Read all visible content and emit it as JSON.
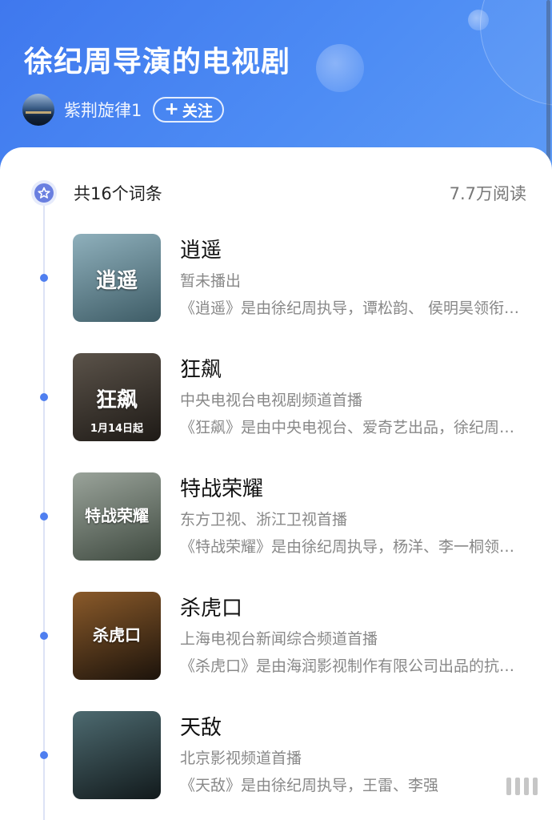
{
  "header": {
    "title": "徐纪周导演的电视剧",
    "author": "紫荆旋律1",
    "follow_label": "关注",
    "follow_plus": "+"
  },
  "summary": {
    "count": "共16个词条",
    "reads": "7.7万阅读"
  },
  "items": [
    {
      "title": "逍遥",
      "subtitle": "暂未播出",
      "desc": "《逍遥》是由徐纪周执导，谭松韵、 侯明昊领衔主演",
      "poster_text": "逍遥",
      "poster_badge": "",
      "colors": [
        "#8fb0bc",
        "#3e5c66"
      ]
    },
    {
      "title": "狂飙",
      "subtitle": "中央电视台电视剧频道首播",
      "desc": "《狂飙》是由中央电视台、爱奇艺出品，徐纪周执导",
      "poster_text": "狂飙",
      "poster_badge": "1月14日起",
      "colors": [
        "#5b534a",
        "#1e1a16"
      ]
    },
    {
      "title": "特战荣耀",
      "subtitle": "东方卫视、浙江卫视首播",
      "desc": "《特战荣耀》是由徐纪周执导，杨洋、李一桐领衔主演",
      "poster_text": "特战荣耀",
      "poster_badge": "",
      "colors": [
        "#9aa39a",
        "#3f4a40"
      ]
    },
    {
      "title": "杀虎口",
      "subtitle": "上海电视台新闻综合频道首播",
      "desc": "《杀虎口》是由海润影视制作有限公司出品的抗战剧",
      "poster_text": "杀虎口",
      "poster_badge": "",
      "colors": [
        "#8a5a2a",
        "#1c130b"
      ]
    },
    {
      "title": "天敌",
      "subtitle": "北京影视频道首播",
      "desc": "《天敌》是由徐纪周执导，王雷、李强",
      "poster_text": "",
      "poster_badge": "",
      "colors": [
        "#4d6a70",
        "#121a1c"
      ]
    }
  ]
}
